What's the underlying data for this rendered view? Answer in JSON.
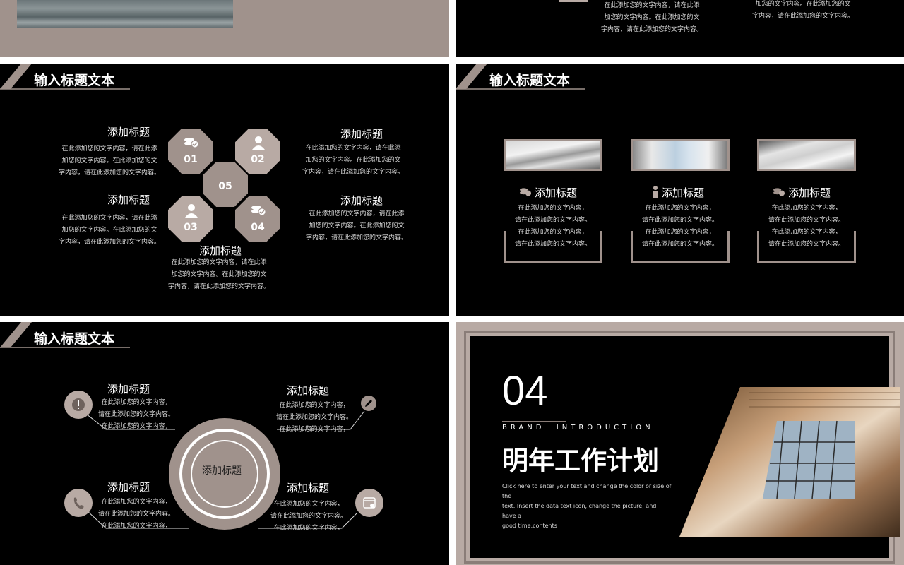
{
  "common": {
    "header_title": "输入标题文本",
    "sub_title": "添加标题",
    "para_a": [
      "在此添加您的文字内容，请在此添",
      "加您的文字内容。在此添加您的文",
      "字内容，请在此添加您的文字内容。"
    ],
    "para_b": [
      "在此添加您的文字内容，请在此添",
      "加您的文字内容。在此添加您的文",
      "字内容，请在此添加您的文字内容。"
    ],
    "para_c": [
      "在此添加您的文字内容，",
      "请在此添加您的文字内容。",
      "在此添加您的文字内容，",
      "请在此添加您的文字内容。"
    ],
    "para_d": [
      "在此添加您的文字内容，",
      "请在此添加您的文字内容。",
      "在此添加您的文字内容，"
    ]
  },
  "slide_top_right": {
    "lines_left": [
      "在此添加您的文字内容，请在此添",
      "加您的文字内容。在此添加您的文",
      "字内容，请在此添加您的文字内容。"
    ],
    "lines_right": [
      "加您的文字内容。在此添加您的文",
      "字内容，请在此添加您的文字内容。"
    ]
  },
  "slide_hex": {
    "octagons": [
      "01",
      "02",
      "05",
      "03",
      "04"
    ]
  },
  "slide_circle": {
    "center_label": "添加标题"
  },
  "slide_cover": {
    "number": "04",
    "brand": "BRAND  INTRODUCTION",
    "title": "明年工作计划",
    "desc": [
      "Click here to enter your text and change the color or size of the",
      "text. Insert the data text icon, change the picture, and have a",
      "good time.contents"
    ]
  },
  "colors": {
    "accent": "#a0928c",
    "accent_light": "#b8aaa4",
    "bg": "#000000"
  }
}
